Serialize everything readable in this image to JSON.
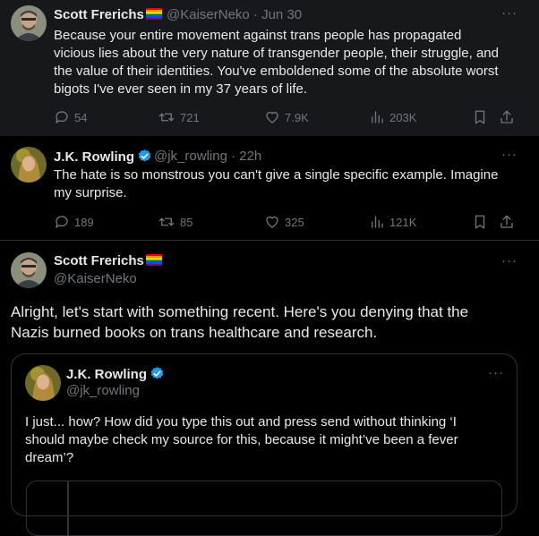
{
  "tweet1": {
    "name": "Scott Frerichs",
    "handle_time": "@KaiserNeko · Jun 30",
    "text_lines": [
      "Because your entire movement against trans people has propagated",
      "vicious lies about the very nature of transgender people, their struggle, and",
      "the value of their identities. You've emboldened some of the absolute worst",
      "bigots I've ever seen in my 37 years of life."
    ],
    "metrics": {
      "replies": "54",
      "reposts": "721",
      "likes": "7.9K",
      "views": "203K"
    }
  },
  "tweet2": {
    "name": "J.K. Rowling",
    "handle_time": "@jk_rowling · 22h",
    "text_lines": [
      "The hate is so monstrous you can't give a single specific example. Imagine",
      "my surprise."
    ],
    "metrics": {
      "replies": "189",
      "reposts": "85",
      "likes": "325",
      "views": "121K"
    }
  },
  "main": {
    "name": "Scott Frerichs",
    "handle": "@KaiserNeko",
    "text_lines": [
      "Alright, let's start with something recent. Here's you denying that the",
      "Nazis burned books on trans healthcare and research."
    ]
  },
  "quote": {
    "name": "J.K. Rowling",
    "handle": "@jk_rowling",
    "text_lines": [
      "I just... how? How did you type this out and press send without thinking ‘I",
      "should maybe check my source for this, because it might’ve been a fever",
      "dream’?"
    ]
  },
  "icons": {
    "more": "more-dots-icon",
    "reply": "reply-icon",
    "repost": "repost-icon",
    "like": "heart-icon",
    "views": "views-icon",
    "bookmark": "bookmark-icon",
    "share": "share-icon",
    "verified": "verified-badge-icon",
    "flag": "rainbow-flag-icon"
  },
  "colors": {
    "verified": "#1d9bf0",
    "muted": "#71767b",
    "text": "#e7e9ea",
    "border": "#2f3336"
  }
}
